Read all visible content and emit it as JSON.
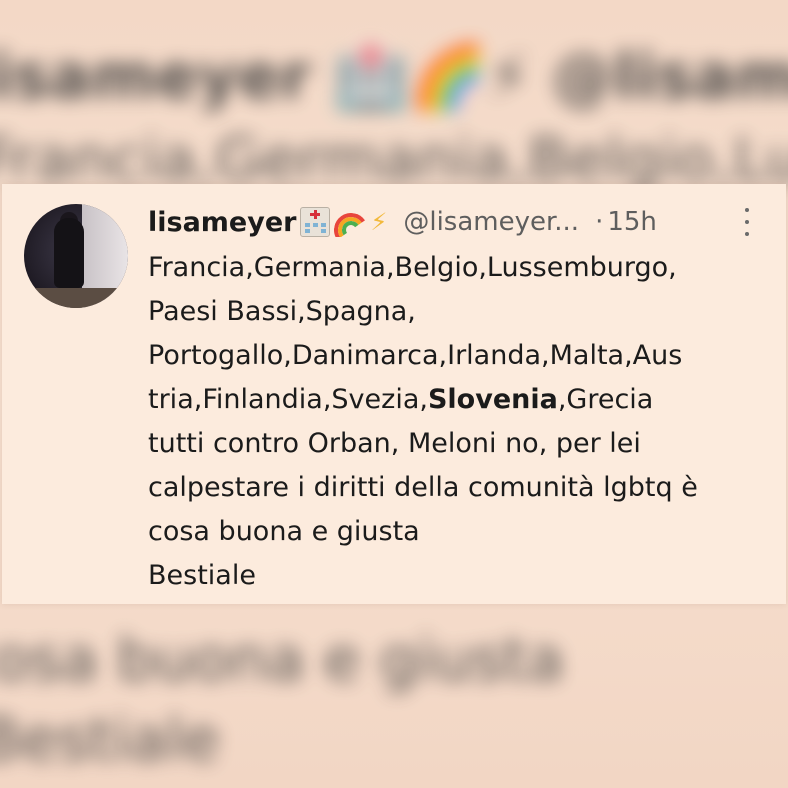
{
  "background": {
    "lines": [
      "lisameyer 🏥🌈⚡ @lisameyer",
      "Francia,Germania,Belgio,Lusse",
      "cosa buona e giusta",
      "Bestiale"
    ]
  },
  "tweet": {
    "display_name": "lisameyer",
    "emojis": [
      "hospital-icon",
      "rainbow-icon",
      "lightning-icon"
    ],
    "handle": "@lisameyer...",
    "separator": "·",
    "time": "15h",
    "text_lines": [
      "Francia,Germania,Belgio,Lussemburgo,",
      "Paesi Bassi,Spagna,",
      "Portogallo,Danimarca,Irlanda,Malta,Aus",
      "tria,Finlandia,Svezia,",
      "tutti contro Orban, Meloni no, per lei",
      "calpestare i diritti della comunità lgbtq è",
      "cosa buona e giusta",
      "Bestiale"
    ],
    "bold_word": "Slovenia",
    "after_bold": ",Grecia"
  },
  "colors": {
    "page_bg": "#f5dccb",
    "card_bg": "#fcebdd",
    "text": "#1b1b1b",
    "muted": "#5e5e5e",
    "bolt": "#f2b93b"
  }
}
